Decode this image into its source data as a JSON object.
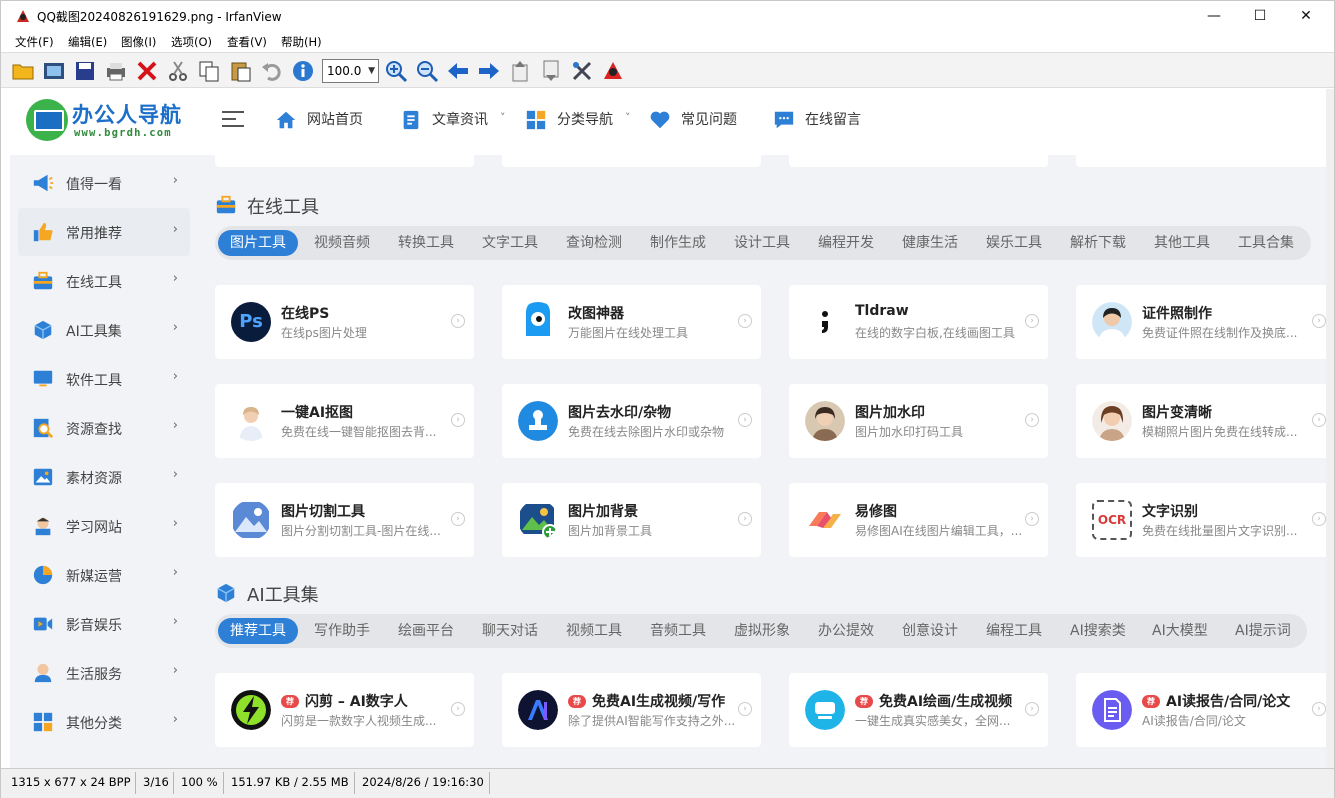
{
  "window": {
    "title": "QQ截图20240826191629.png - IrfanView",
    "minimize": "—",
    "maximize": "☐",
    "close": "✕"
  },
  "menu": [
    "文件(F)",
    "编辑(E)",
    "图像(I)",
    "选项(O)",
    "查看(V)",
    "帮助(H)"
  ],
  "toolbar": {
    "zoom_value": "100.0",
    "icons": [
      "open-folder-icon",
      "slideshow-icon",
      "save-icon",
      "print-icon",
      "delete-icon",
      "cut-icon",
      "copy-icon",
      "paste-icon",
      "undo-icon",
      "info-icon",
      "zoom-in-icon",
      "zoom-out-icon",
      "previous-icon",
      "next-icon",
      "first-page-icon",
      "last-page-icon",
      "settings-icon",
      "irfanview-logo-icon"
    ]
  },
  "site": {
    "logo_text": "办公人导航",
    "logo_url": "www.bgrdh.com",
    "nav": [
      {
        "label": "网站首页",
        "icon": "home-icon",
        "arrow": ""
      },
      {
        "label": "文章资讯",
        "icon": "article-icon",
        "arrow": "˅"
      },
      {
        "label": "分类导航",
        "icon": "grid-icon",
        "arrow": "˅"
      },
      {
        "label": "常见问题",
        "icon": "heart-icon",
        "arrow": ""
      },
      {
        "label": "在线留言",
        "icon": "message-icon",
        "arrow": ""
      }
    ],
    "sidebar": [
      {
        "label": "值得一看",
        "icon": "megaphone-icon"
      },
      {
        "label": "常用推荐",
        "icon": "thumbs-up-icon"
      },
      {
        "label": "在线工具",
        "icon": "toolbox-icon"
      },
      {
        "label": "AI工具集",
        "icon": "cube-icon"
      },
      {
        "label": "软件工具",
        "icon": "monitor-icon"
      },
      {
        "label": "资源查找",
        "icon": "search-doc-icon"
      },
      {
        "label": "素材资源",
        "icon": "image-icon"
      },
      {
        "label": "学习网站",
        "icon": "student-icon"
      },
      {
        "label": "新媒运营",
        "icon": "pie-chart-icon"
      },
      {
        "label": "影音娱乐",
        "icon": "video-icon"
      },
      {
        "label": "生活服务",
        "icon": "person-icon"
      },
      {
        "label": "其他分类",
        "icon": "apps-icon"
      }
    ],
    "chevron": "›",
    "online_tools": {
      "title": "在线工具",
      "tabs": [
        "图片工具",
        "视频音频",
        "转换工具",
        "文字工具",
        "查询检测",
        "制作生成",
        "设计工具",
        "编程开发",
        "健康生活",
        "娱乐工具",
        "解析下载",
        "其他工具",
        "工具合集"
      ],
      "cards": [
        {
          "title": "在线PS",
          "desc": "在线ps图片处理"
        },
        {
          "title": "改图神器",
          "desc": "万能图片在线处理工具"
        },
        {
          "title": "Tldraw",
          "desc": "在线的数字白板,在线画图工具"
        },
        {
          "title": "证件照制作",
          "desc": "免费证件照在线制作及换底..."
        },
        {
          "title": "一键AI抠图",
          "desc": "免费在线一键智能抠图去背..."
        },
        {
          "title": "图片去水印/杂物",
          "desc": "免费在线去除图片水印或杂物"
        },
        {
          "title": "图片加水印",
          "desc": "图片加水印打码工具"
        },
        {
          "title": "图片变清晰",
          "desc": "模糊照片图片免费在线转成..."
        },
        {
          "title": "图片切割工具",
          "desc": "图片分割切割工具-图片在线..."
        },
        {
          "title": "图片加背景",
          "desc": "图片加背景工具"
        },
        {
          "title": "易修图",
          "desc": "易修图AI在线图片编辑工具，..."
        },
        {
          "title": "文字识别",
          "desc": "免费在线批量图片文字识别..."
        }
      ],
      "ocr_label": "OCR"
    },
    "ai_tools": {
      "title": "AI工具集",
      "tabs": [
        "推荐工具",
        "写作助手",
        "绘画平台",
        "聊天对话",
        "视频工具",
        "音频工具",
        "虚拟形象",
        "办公提效",
        "创意设计",
        "编程工具",
        "AI搜索类",
        "AI大模型",
        "AI提示词"
      ],
      "badge": "荐",
      "cards": [
        {
          "title": "闪剪 – AI数字人",
          "desc": "闪剪是一款数字人视频生成..."
        },
        {
          "title": "免费AI生成视频/写作",
          "desc": "除了提供AI智能写作支持之外..."
        },
        {
          "title": "免费AI绘画/生成视频",
          "desc": "一键生成真实感美女，全网..."
        },
        {
          "title": "AI读报告/合同/论文",
          "desc": "AI读报告/合同/论文"
        }
      ]
    }
  },
  "status": {
    "dims": "1315 x 677 x 24 BPP",
    "page": "3/16",
    "zoom": "100 %",
    "size": "151.97 KB / 2.55 MB",
    "datetime": "2024/8/26 / 19:16:30"
  },
  "colors": {
    "accent": "#2e7fd6",
    "logo_blue": "#1c6fc8",
    "logo_green": "#2e8b3a"
  }
}
